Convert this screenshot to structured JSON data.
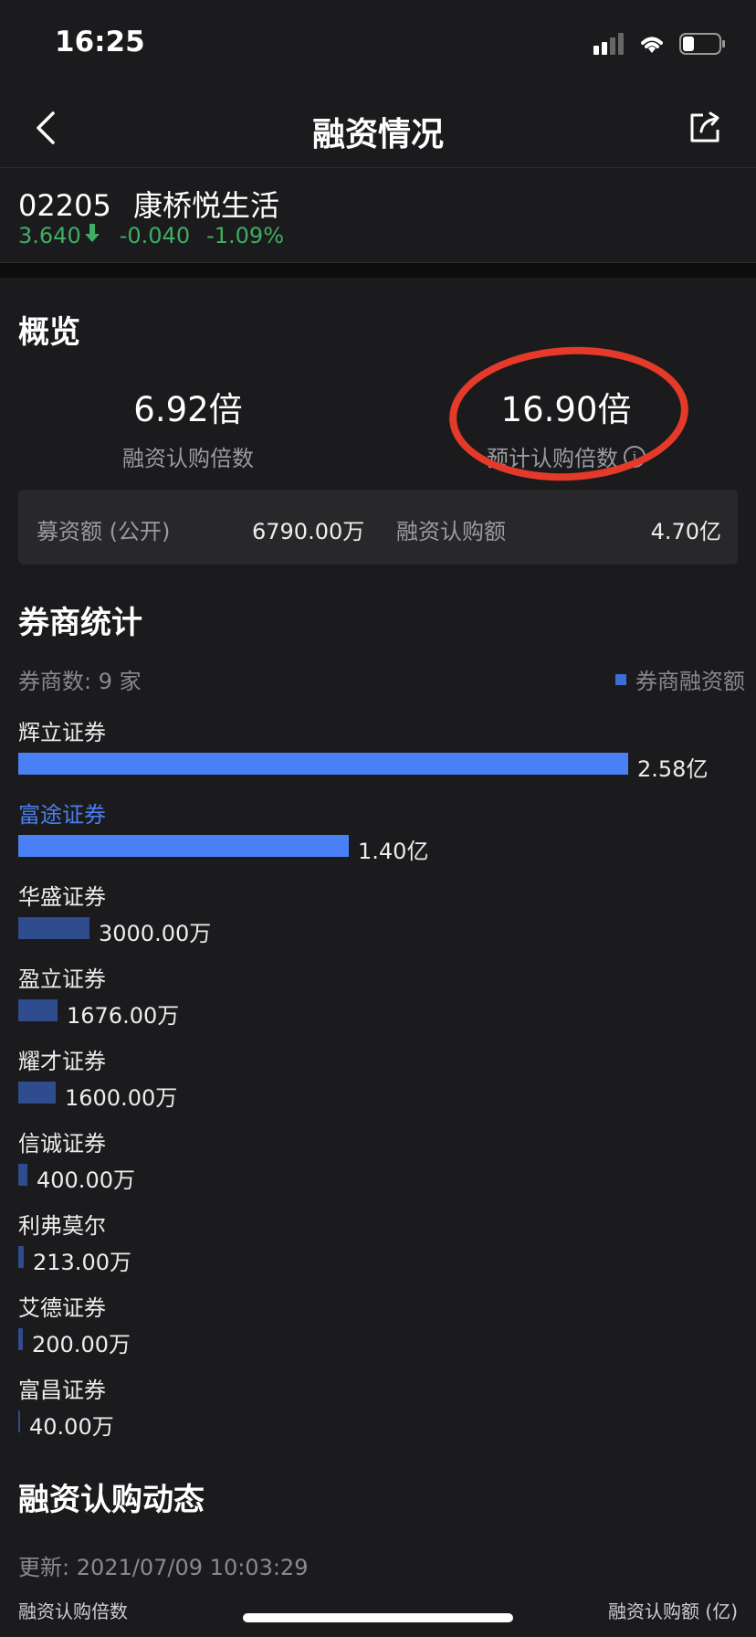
{
  "status_bar": {
    "time": "16:25",
    "icons": [
      "signal-icon",
      "wifi-icon",
      "battery-icon"
    ]
  },
  "nav": {
    "title": "融资情况",
    "back_icon": "chevron-left-icon",
    "share_icon": "share-icon"
  },
  "stock": {
    "code": "02205",
    "name": "康桥悦生活",
    "price": "3.640",
    "direction_icon": "arrow-down-icon",
    "change": "-0.040",
    "change_pct": "-1.09%",
    "color": "#3fae62"
  },
  "overview": {
    "title": "概览",
    "financing_multiple": {
      "value": "6.92倍",
      "label": "融资认购倍数"
    },
    "expected_multiple": {
      "value": "16.90倍",
      "label": "预计认购倍数"
    },
    "raise_amount": {
      "label": "募资额 (公开)",
      "value": "6790.00万"
    },
    "financing_amount": {
      "label": "融资认购额",
      "value": "4.70亿"
    }
  },
  "brokers": {
    "title": "券商统计",
    "count_label": "券商数: 9 家",
    "legend": "券商融资额",
    "accent_color": "#3a6ed8",
    "items": [
      {
        "name": "辉立证券",
        "value": "2.58亿",
        "amount_wan": 25800
      },
      {
        "name": "富途证券",
        "value": "1.40亿",
        "amount_wan": 14000
      },
      {
        "name": "华盛证券",
        "value": "3000.00万",
        "amount_wan": 3000
      },
      {
        "name": "盈立证券",
        "value": "1676.00万",
        "amount_wan": 1676
      },
      {
        "name": "耀才证券",
        "value": "1600.00万",
        "amount_wan": 1600
      },
      {
        "name": "信诚证券",
        "value": "400.00万",
        "amount_wan": 400
      },
      {
        "name": "利弗莫尔",
        "value": "213.00万",
        "amount_wan": 213
      },
      {
        "name": "艾德证券",
        "value": "200.00万",
        "amount_wan": 200
      },
      {
        "name": "富昌证券",
        "value": "40.00万",
        "amount_wan": 40
      }
    ]
  },
  "dynamics": {
    "title": "融资认购动态",
    "update": "更新: 2021/07/09 10:03:29",
    "left_label": "融资认购倍数",
    "right_label": "融资认购额 (亿)"
  }
}
